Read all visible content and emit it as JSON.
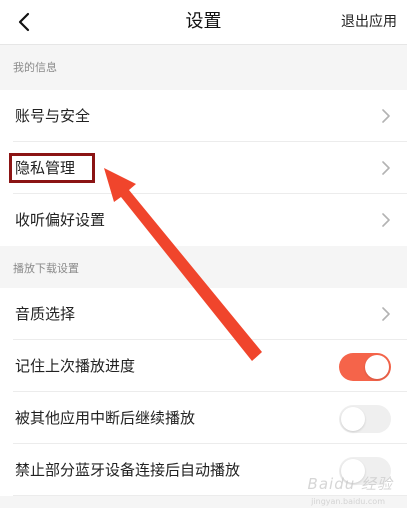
{
  "navbar": {
    "title": "设置",
    "right_label": "退出应用"
  },
  "sections": [
    {
      "header": "我的信息"
    },
    {
      "header": "播放下载设置"
    }
  ],
  "rows": [
    {
      "label": "账号与安全"
    },
    {
      "label": "隐私管理"
    },
    {
      "label": "收听偏好设置"
    },
    {
      "label": "音质选择"
    },
    {
      "label": "记住上次播放进度",
      "toggle": true
    },
    {
      "label": "被其他应用中断后继续播放",
      "toggle": false
    },
    {
      "label": "禁止部分蓝牙设备连接后自动播放",
      "toggle": false
    }
  ],
  "colors": {
    "accent": "#f5644a",
    "highlight": "#8b1414",
    "arrow": "#f0452c"
  },
  "watermark": {
    "text": "Baidu 经验",
    "sub": "jingyan.baidu.com"
  }
}
